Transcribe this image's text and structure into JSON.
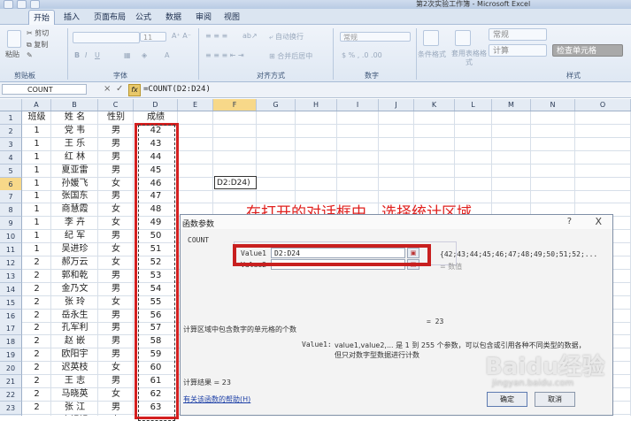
{
  "window": {
    "title": "第2次实验工作簿 - Microsoft Excel"
  },
  "tabs": [
    "开始",
    "插入",
    "页面布局",
    "公式",
    "数据",
    "审阅",
    "视图"
  ],
  "ribbon": {
    "clipboard": {
      "cut": "剪切",
      "copy": "复制",
      "paste": "粘贴",
      "label": "剪贴板"
    },
    "font": {
      "size": "11",
      "label": "字体"
    },
    "align": {
      "wrap": "自动换行",
      "merge": "合并后居中",
      "label": "对齐方式"
    },
    "number": {
      "format": "常规",
      "label": "数字"
    },
    "styles": {
      "cond": "条件格式",
      "table": "套用表格格式",
      "normal": "常规",
      "calc": "计算",
      "check": "检查单元格",
      "label": "样式"
    }
  },
  "formula_bar": {
    "name_box": "COUNT",
    "formula": "=COUNT(D2:D24)",
    "cancel": "×",
    "enter": "✓",
    "fx": "fx"
  },
  "columns": [
    "A",
    "B",
    "C",
    "D",
    "E",
    "F",
    "G",
    "H",
    "I",
    "J",
    "K",
    "L",
    "M",
    "N",
    "O"
  ],
  "rows": [
    {
      "n": "1",
      "a": "班级",
      "b": "姓  名",
      "c": "性别",
      "d": "成绩"
    },
    {
      "n": "2",
      "a": "1",
      "b": "党  韦",
      "c": "男",
      "d": "42"
    },
    {
      "n": "3",
      "a": "1",
      "b": "王  乐",
      "c": "男",
      "d": "43"
    },
    {
      "n": "4",
      "a": "1",
      "b": "红  林",
      "c": "男",
      "d": "44"
    },
    {
      "n": "5",
      "a": "1",
      "b": "夏亚雷",
      "c": "男",
      "d": "45"
    },
    {
      "n": "6",
      "a": "1",
      "b": "孙媛飞",
      "c": "女",
      "d": "46"
    },
    {
      "n": "7",
      "a": "1",
      "b": "张国东",
      "c": "男",
      "d": "47"
    },
    {
      "n": "8",
      "a": "1",
      "b": "商慧霞",
      "c": "女",
      "d": "48"
    },
    {
      "n": "9",
      "a": "1",
      "b": "李  卉",
      "c": "女",
      "d": "49"
    },
    {
      "n": "10",
      "a": "1",
      "b": "纪  军",
      "c": "男",
      "d": "50"
    },
    {
      "n": "11",
      "a": "1",
      "b": "吴进珍",
      "c": "女",
      "d": "51"
    },
    {
      "n": "12",
      "a": "2",
      "b": "郝万云",
      "c": "女",
      "d": "52"
    },
    {
      "n": "13",
      "a": "2",
      "b": "郭和乾",
      "c": "男",
      "d": "53"
    },
    {
      "n": "14",
      "a": "2",
      "b": "金乃文",
      "c": "男",
      "d": "54"
    },
    {
      "n": "15",
      "a": "2",
      "b": "张  玲",
      "c": "女",
      "d": "55"
    },
    {
      "n": "16",
      "a": "2",
      "b": "岳永生",
      "c": "男",
      "d": "56"
    },
    {
      "n": "17",
      "a": "2",
      "b": "孔军利",
      "c": "男",
      "d": "57"
    },
    {
      "n": "18",
      "a": "2",
      "b": "赵  嵌",
      "c": "男",
      "d": "58"
    },
    {
      "n": "19",
      "a": "2",
      "b": "欧阳宇",
      "c": "男",
      "d": "59"
    },
    {
      "n": "20",
      "a": "2",
      "b": "迟英枝",
      "c": "女",
      "d": "60"
    },
    {
      "n": "21",
      "a": "2",
      "b": "王  志",
      "c": "男",
      "d": "61"
    },
    {
      "n": "22",
      "a": "2",
      "b": "马晓英",
      "c": "女",
      "d": "62"
    },
    {
      "n": "23",
      "a": "2",
      "b": "张  江",
      "c": "男",
      "d": "63"
    },
    {
      "n": "24",
      "a": "2",
      "b": "齐银娟",
      "c": "女",
      "d": "64"
    }
  ],
  "f6_text": "D2:D24)",
  "annotation": "在打开的对话框中，选择统计区域",
  "dialog": {
    "title": "函数参数",
    "help": "?",
    "close": "X",
    "function": "COUNT",
    "value1_label": "Value1",
    "value1": "D2:D24",
    "value1_result": "{42;43;44;45;46;47;48;49;50;51;52;...",
    "value2_label": "Value2",
    "value2": "",
    "value2_result": "= 数值",
    "equals": "= 23",
    "description": "计算区域中包含数字的单元格的个数",
    "arg_desc_label": "Value1:",
    "arg_desc": "value1,value2,... 是 1 到 255 个参数，可以包含或引用各种不同类型的数据，",
    "arg_desc2": "但只对数字型数据进行计数",
    "result": "计算结果 = 23",
    "help_link": "有关该函数的帮助(H)",
    "ok": "确定",
    "cancel": "取消"
  },
  "watermark": {
    "brand": "Baidu经验",
    "url": "jingyan.baidu.com"
  }
}
